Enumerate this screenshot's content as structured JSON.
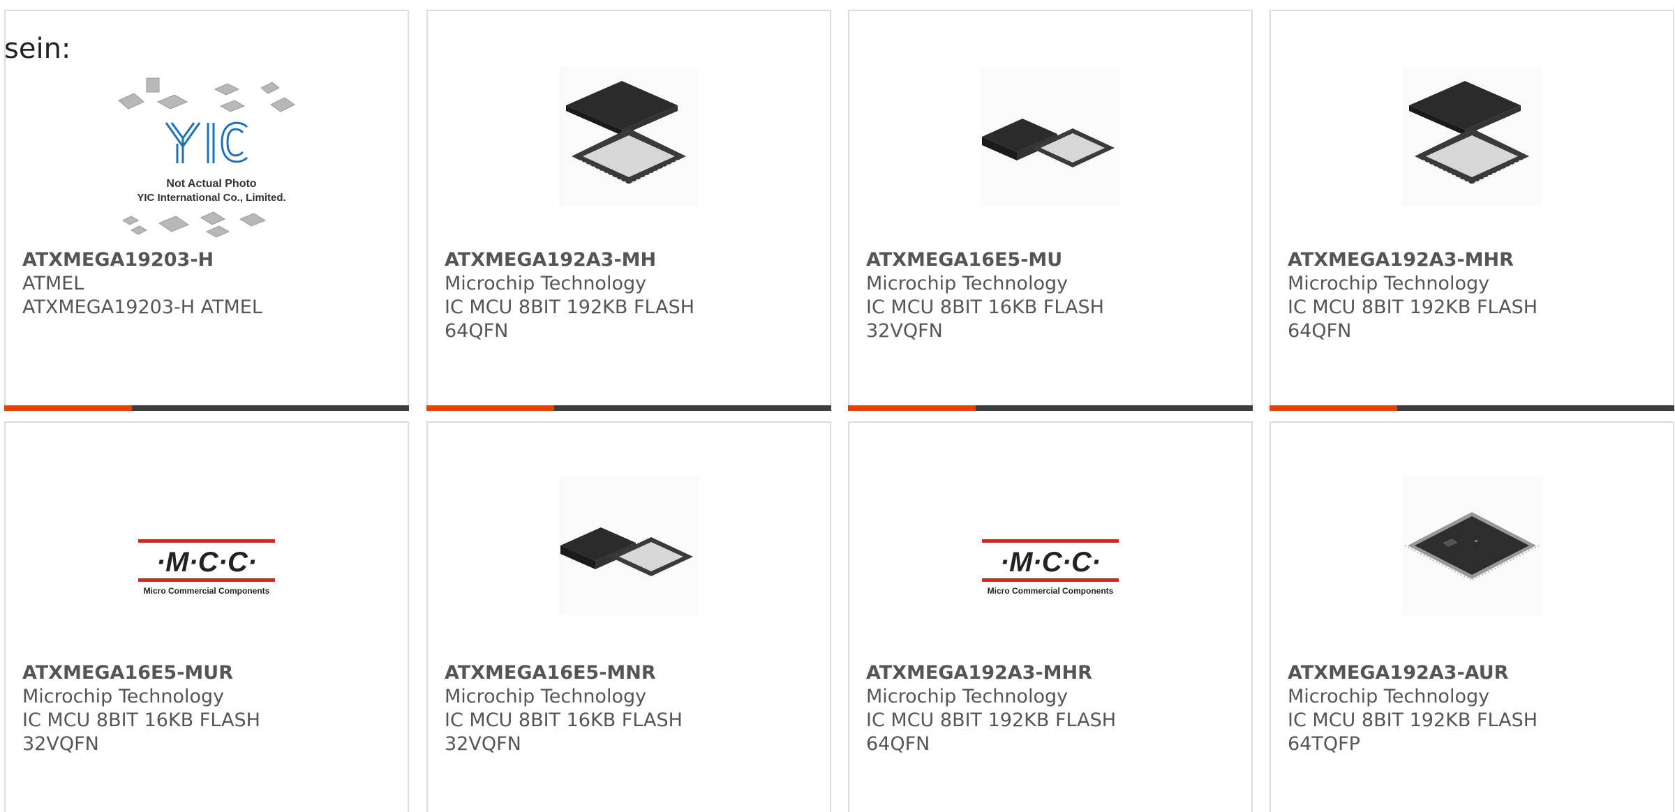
{
  "intro_text": "sein:",
  "products": [
    {
      "part": "ATXMEGA19203-H",
      "maker": "ATMEL",
      "desc1": "ATXMEGA19203-H ATMEL",
      "desc2": "",
      "image": "yic-placeholder",
      "placeholder": {
        "line1": "Not Actual Photo",
        "line2": "YIC International Co., Limited.",
        "logo": "YIC"
      }
    },
    {
      "part": "ATXMEGA192A3-MH",
      "maker": "Microchip Technology",
      "desc1": "IC MCU 8BIT 192KB FLASH",
      "desc2": "64QFN",
      "image": "qfn-chip-stack"
    },
    {
      "part": "ATXMEGA16E5-MU",
      "maker": "Microchip Technology",
      "desc1": "IC MCU 8BIT 16KB FLASH",
      "desc2": "32VQFN",
      "image": "qfn-chip-pair"
    },
    {
      "part": "ATXMEGA192A3-MHR",
      "maker": "Microchip Technology",
      "desc1": "IC MCU 8BIT 192KB FLASH",
      "desc2": "64QFN",
      "image": "qfn-chip-stack"
    },
    {
      "part": "ATXMEGA16E5-MUR",
      "maker": "Microchip Technology",
      "desc1": "IC MCU 8BIT 16KB FLASH",
      "desc2": "32VQFN",
      "image": "mcc-logo",
      "mcc": {
        "mark": "·M·C·C·",
        "sub": "Micro Commercial Components"
      }
    },
    {
      "part": "ATXMEGA16E5-MNR",
      "maker": "Microchip Technology",
      "desc1": "IC MCU 8BIT 16KB FLASH",
      "desc2": "32VQFN",
      "image": "qfn-chip-pair"
    },
    {
      "part": "ATXMEGA192A3-MHR",
      "maker": "Microchip Technology",
      "desc1": "IC MCU 8BIT 192KB FLASH",
      "desc2": "64QFN",
      "image": "mcc-logo",
      "mcc": {
        "mark": "·M·C·C·",
        "sub": "Micro Commercial Components"
      }
    },
    {
      "part": "ATXMEGA192A3-AUR",
      "maker": "Microchip Technology",
      "desc1": "IC MCU 8BIT 192KB FLASH",
      "desc2": "64TQFP",
      "image": "tqfp-chip"
    }
  ],
  "colors": {
    "accent": "#ea3d12",
    "bar": "#3d3d3d",
    "border": "#dcdcdc",
    "text": "#555555"
  }
}
